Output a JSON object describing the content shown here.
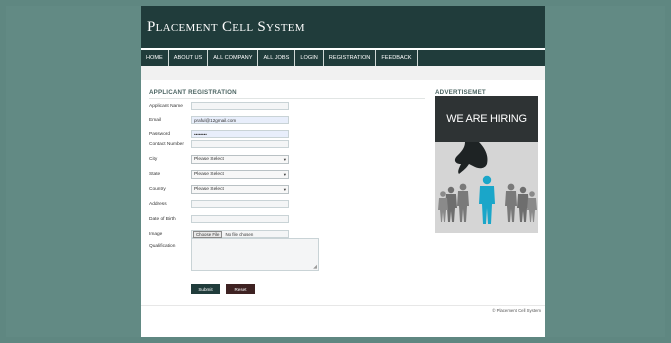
{
  "site": {
    "title": "Placement Cell System"
  },
  "nav": {
    "items": [
      "HOME",
      "ABOUT US",
      "ALL COMPANY",
      "ALL JOBS",
      "LOGIN",
      "REGISTRATION",
      "FEEDBACK"
    ]
  },
  "registration": {
    "title": "APPLICANT REGISTRATION",
    "fields": {
      "name": {
        "label": "Applicant Name",
        "value": ""
      },
      "email": {
        "label": "Email",
        "value": "praful@12gmail.com"
      },
      "password": {
        "label": "Password",
        "value": "••••••••"
      },
      "contact": {
        "label": "Contact Number",
        "value": ""
      },
      "city": {
        "label": "City",
        "value": "Please Select"
      },
      "state": {
        "label": "State",
        "value": "Please Select"
      },
      "country": {
        "label": "Country",
        "value": "Please Select"
      },
      "address": {
        "label": "Address",
        "value": ""
      },
      "dob": {
        "label": "Date of Birth",
        "value": ""
      },
      "image": {
        "label": "Image",
        "button": "Choose File",
        "status": "No file chosen"
      },
      "qualification": {
        "label": "Qualification",
        "value": ""
      }
    },
    "submit_label": "Submit",
    "reset_label": "Reset"
  },
  "advert": {
    "title": "ADVERTISEMET",
    "banner_text": "WE ARE HIRING"
  },
  "footer": {
    "text": "© Placement Cell System"
  },
  "colors": {
    "header_bg": "#203c3b",
    "submit_bg": "#203c3b",
    "reset_bg": "#3e2222",
    "page_bg": "#5f8781"
  }
}
